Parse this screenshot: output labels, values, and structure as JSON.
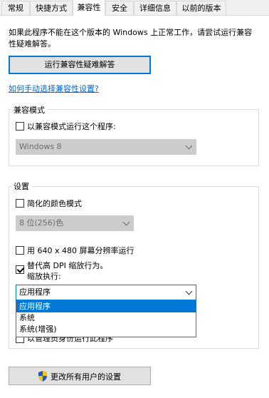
{
  "tabs": [
    {
      "label": "常规"
    },
    {
      "label": "快捷方式"
    },
    {
      "label": "兼容性"
    },
    {
      "label": "安全"
    },
    {
      "label": "详细信息"
    },
    {
      "label": "以前的版本"
    }
  ],
  "description": "如果此程序不能在这个版本的 Windows 上正常工作，请尝试运行兼容性疑难解答。",
  "troubleshoot_button": "运行兼容性疑难解答",
  "manual_link": "如何手动选择兼容性设置?",
  "compat_mode": {
    "title": "兼容模式",
    "checkbox_label": "以兼容模式运行这个程序:",
    "checked": false,
    "os_select_value": "Windows 8"
  },
  "settings": {
    "title": "设置",
    "reduced_color_label": "简化的颜色模式",
    "reduced_color_checked": false,
    "color_select_value": "8 位(256)色",
    "res640_label": "用 640 x 480 屏幕分辨率运行",
    "res640_checked": false,
    "dpi_label_line1": "替代高 DPI 缩放行为。",
    "dpi_label_line2": "缩放执行:",
    "dpi_checked": true,
    "dpi_select_value": "应用程序",
    "dpi_options": [
      "应用程序",
      "系统",
      "系统(增强)"
    ],
    "dpi_selected_index": 0,
    "admin_label_partial": "以管理员身份运行此程序",
    "admin_checked": false
  },
  "all_users_button": "更改所有用户的设置",
  "colors": {
    "accent": "#0078d7",
    "link": "#0066cc",
    "disabled_fill": "#cccccc"
  }
}
